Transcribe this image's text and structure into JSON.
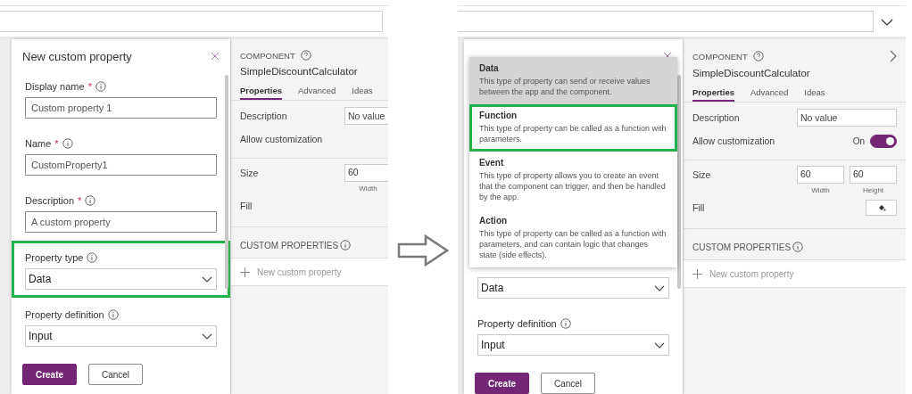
{
  "screens": [
    {
      "formula_bar": {
        "chevron": false
      },
      "dialog": {
        "title": "New custom property",
        "fields": [
          {
            "label": "Display name",
            "required_mark": "*",
            "kind": "input",
            "value": "Custom property 1",
            "highlighted": false
          },
          {
            "label": "Name",
            "required_mark": "*",
            "kind": "input",
            "value": "CustomProperty1",
            "highlighted": false
          },
          {
            "label": "Description",
            "required_mark": "*",
            "kind": "input",
            "value": "A custom property",
            "highlighted": false
          },
          {
            "label": "Property type",
            "kind": "select",
            "value": "Data",
            "highlighted": true
          },
          {
            "label": "Property definition",
            "kind": "select",
            "value": "Input",
            "highlighted": false
          }
        ],
        "buttons": [
          {
            "label": "Create",
            "primary": true
          },
          {
            "label": "Cancel",
            "primary": false
          }
        ]
      },
      "panel": {
        "heading": "COMPONENT",
        "title": "SimpleDiscountCalculator",
        "expand_chevron": false,
        "tabs": [
          {
            "label": "Properties",
            "selected": true
          },
          {
            "label": "Advanced",
            "selected": false
          },
          {
            "label": "Ideas",
            "selected": false
          }
        ],
        "description": {
          "label": "Description",
          "value": "No value"
        },
        "customization": {
          "label": "Allow customization"
        },
        "size": {
          "label": "Size",
          "fields": [
            {
              "value": "60",
              "caption": "Width"
            }
          ]
        },
        "fill": {
          "label": "Fill",
          "button": false
        },
        "custom_properties": {
          "heading": "CUSTOM PROPERTIES",
          "add_label": "New custom property"
        }
      }
    },
    {
      "formula_bar": {
        "chevron": true
      },
      "dialog": {
        "menu": [
          {
            "title": "Data",
            "text": "This type of property can send or receive values between the app and the component.",
            "selected": true,
            "highlighted": false
          },
          {
            "title": "Function",
            "text": "This type of property can be called as a function with parameters.",
            "selected": false,
            "highlighted": true
          },
          {
            "title": "Event",
            "text": "This type of property allows you to create an event that the component can trigger, and then be handled by the app.",
            "selected": false,
            "highlighted": false
          },
          {
            "title": "Action",
            "text": "This type of property can be called as a function with parameters, and can contain logic that changes state (side effects).",
            "selected": false,
            "highlighted": false
          }
        ],
        "fields": [
          {
            "kind": "select",
            "value": "Data",
            "highlighted": false
          },
          {
            "label": "Property definition",
            "kind": "select",
            "value": "Input",
            "highlighted": false
          }
        ],
        "buttons": [
          {
            "label": "Create",
            "primary": true
          },
          {
            "label": "Cancel",
            "primary": false
          }
        ]
      },
      "panel": {
        "heading": "COMPONENT",
        "title": "SimpleDiscountCalculator",
        "expand_chevron": true,
        "tabs": [
          {
            "label": "Properties",
            "selected": true
          },
          {
            "label": "Advanced",
            "selected": false
          },
          {
            "label": "Ideas",
            "selected": false
          }
        ],
        "description": {
          "label": "Description",
          "value": "No value"
        },
        "customization": {
          "label": "Allow customization",
          "toggle": {
            "on": true,
            "text": "On"
          }
        },
        "size": {
          "label": "Size",
          "fields": [
            {
              "value": "60",
              "caption": "Width"
            },
            {
              "value": "60",
              "caption": "Height"
            }
          ]
        },
        "fill": {
          "label": "Fill",
          "button": true
        },
        "custom_properties": {
          "heading": "CUSTOM PROPERTIES",
          "add_label": "New custom property"
        }
      }
    }
  ]
}
